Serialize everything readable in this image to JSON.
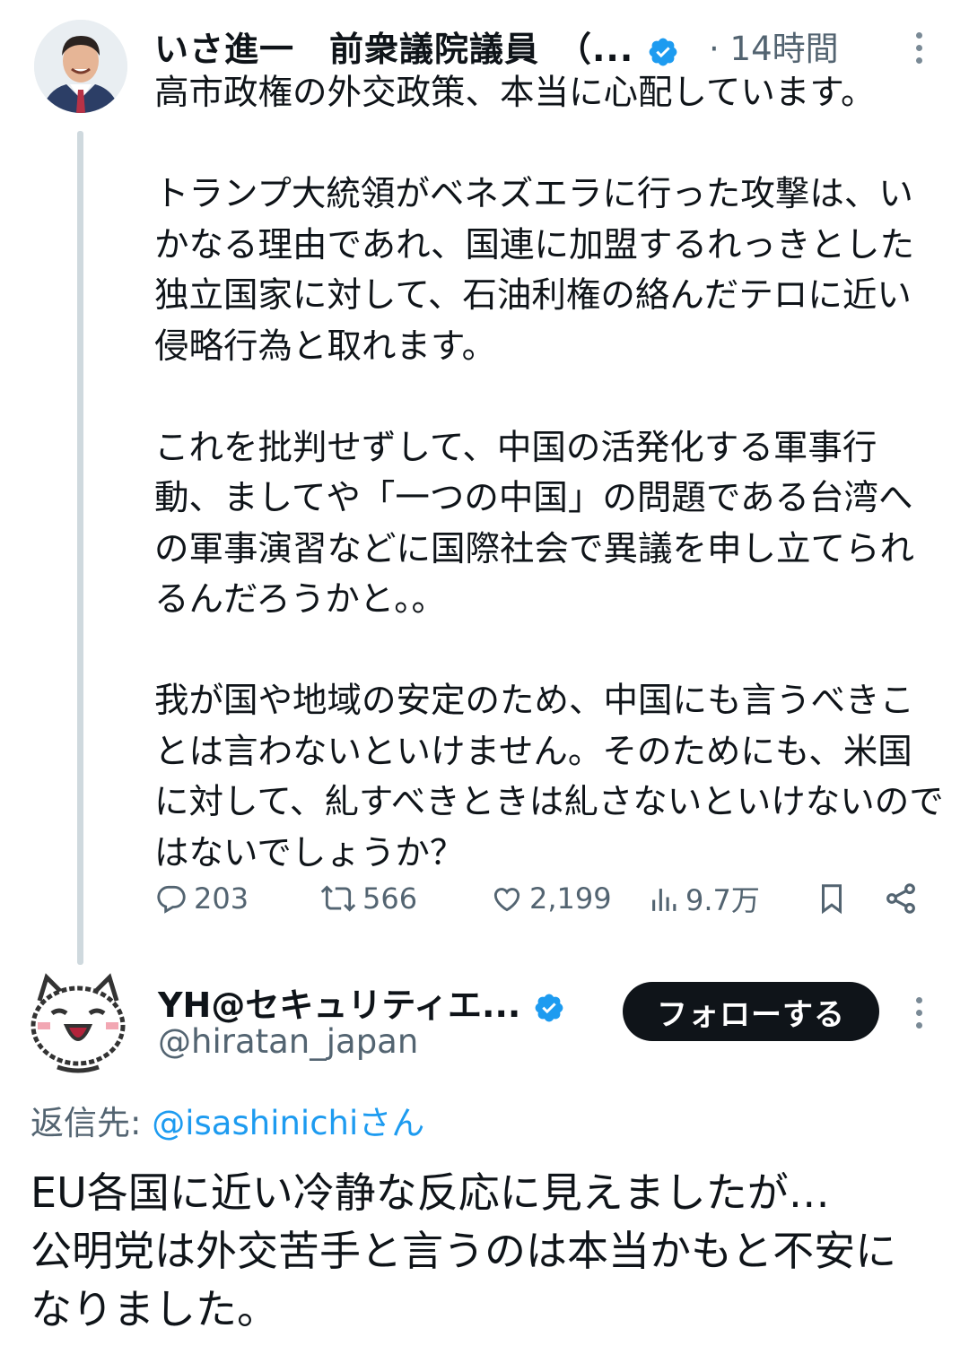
{
  "tweet1": {
    "author_name": "いさ進一　前衆議院議員　（...",
    "time": "· 14時間",
    "text": "高市政権の外交政策、本当に心配しています。\n\nトランプ大統領がベネズエラに行った攻撃は、いかなる理由であれ、国連に加盟するれっきとした独立国家に対して、石油利権の絡んだテロに近い侵略行為と取れます。\n\nこれを批判せずして、中国の活発化する軍事行動、ましてや「一つの中国」の問題である台湾への軍事演習などに国際社会で異議を申し立てられるんだろうかと。。\n\n我が国や地域の安定のため、中国にも言うべきことは言わないといけません。そのためにも、米国に対して、糺すべきときは糺さないといけないのではないでしょうか？",
    "replies": "203",
    "retweets": "566",
    "likes": "2,199",
    "views": "9.7万"
  },
  "tweet2": {
    "author_name": "YH@セキュリティエ...",
    "handle": "@hiratan_japan",
    "follow_label": "フォローする",
    "reply_prefix": "返信先: ",
    "reply_mention": "@isashinichiさん",
    "text": "EU各国に近い冷静な反応に見えましたが…\n公明党は外交苦手と言うのは本当かもと不安になりました。"
  },
  "colors": {
    "verified": "#1d9bf0",
    "muted": "#536471",
    "text": "#0f1419",
    "link": "#1d9bf0",
    "follow_button": "#0f1419"
  },
  "icons": [
    "verified-badge-icon",
    "more-icon",
    "reply-icon",
    "retweet-icon",
    "like-icon",
    "views-icon",
    "bookmark-icon",
    "share-icon"
  ]
}
